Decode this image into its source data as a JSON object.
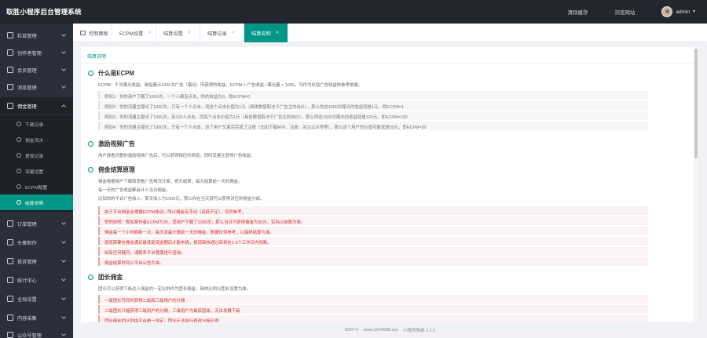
{
  "app": {
    "title": "取胜小程序后台管理系统"
  },
  "topbar": {
    "clear_cache": "清除缓存",
    "browse_site": "浏览网站",
    "user": "admin"
  },
  "sidebar": {
    "items": [
      {
        "label": "栏目管理"
      },
      {
        "label": "创作者管理"
      },
      {
        "label": "会员管理"
      },
      {
        "label": "消息管理"
      },
      {
        "label": "佣金管理"
      },
      {
        "label": "订单管理"
      },
      {
        "label": "头像制作"
      },
      {
        "label": "投诉管理"
      },
      {
        "label": "统计中心"
      },
      {
        "label": "全局设置"
      },
      {
        "label": "内容采集"
      },
      {
        "label": "公众号管理"
      }
    ],
    "sub_items": [
      {
        "label": "下载记录"
      },
      {
        "label": "佣金流水"
      },
      {
        "label": "提现记录"
      },
      {
        "label": "流量设置"
      },
      {
        "label": "ECPM配置"
      },
      {
        "label": "结算说明"
      }
    ]
  },
  "tabs": [
    {
      "label": "控制面板"
    },
    {
      "label": "ECPM设置"
    },
    {
      "label": "结算设置"
    },
    {
      "label": "结算记录"
    },
    {
      "label": "结算说明"
    }
  ],
  "panel": {
    "title": "结算说明",
    "s1": {
      "heading": "什么是ECPM",
      "intro": "ECPM：千次曝光收益。是指展示1000次广告（曝光）所获得的收益，ECPM = 广告收益 / 曝光量 × 1000。可作为评估广告收益的参考依据。",
      "examples": [
        "例如1：你的用户下载了1000次，一个人都没点击，你的收益为0，即ECPM=0",
        "例如2：你的流量主曝光了1000次，只有一个人点击，而这个点击价值为1元（具体数值取决于广告主的出价），那么你这1000次曝光的收益就是1元，即ECPM=1",
        "例如3：你的流量主曝光了1000次，有100人点击，而每个点击价值为1元（具体数值取决于广告主的出价），那么你这1000次曝光的收益就是100元，即ECPM=100",
        "例如4：你的流量主曝光了1000次，只有一个人点击，这个用户又激活完成了注册（比如下载APP、注册、关注公众号等），那么这个用户的价值可能就是30元，即ECPM=30"
      ]
    },
    "s2": {
      "heading": "激励视频广告",
      "body": "用户观看完整的激励视频广告后，可以获得相应的奖励，同时流量主获得广告收益。"
    },
    "s3": {
      "heading": "佣金结算原理",
      "lines": [
        "佣金根据用户下载和观看广告情况计算，按天结算，每天结算前一天的佣金。",
        "每一天的广告收益都会计入当日佣金。",
        "比如你的平台广告收入：某天收入为1000元，那么你在当天就可以获得对应的佣金分成。"
      ],
      "notes": [
        "由于平台佣金会根据ECPM波动，所以佣金有浮动（高低不定），仅供参考。",
        "举例说明：假如某作者ECPM为30，其用户下载了1000次，那么当日可获得佣金为30元，实际以结算为准。",
        "佣金每一个小时刷新一次，每天凌晨计算前一天的佣金，数据仅供参考，以最终结算为准。",
        "提现需要在佣金满足最低提现金额后才能申请，提现审核通过后将在1-3个工作日内到账。",
        "如有任何疑问，请联系平台客服进行咨询。",
        "佣金结算时间以平台公告为准。"
      ]
    },
    "s4": {
      "heading": "团长佣金",
      "intro": "团长可以获得下级达人佣金的一定比例作为团长佣金，具体比例以团长设置为准。",
      "notes": [
        "一级团长可同时获得二级和三级用户的分佣",
        "二级团长只能获得三级用户的分佣，三级用户为最底层级，无法发展下级",
        "团长佣金的比例由平台统一设定，团长无法自行修改分佣比例"
      ]
    }
  },
  "footer": {
    "year": "2024 ©",
    "site": "www.1024888.xyz",
    "system": "小程序系统 3.2.1"
  }
}
